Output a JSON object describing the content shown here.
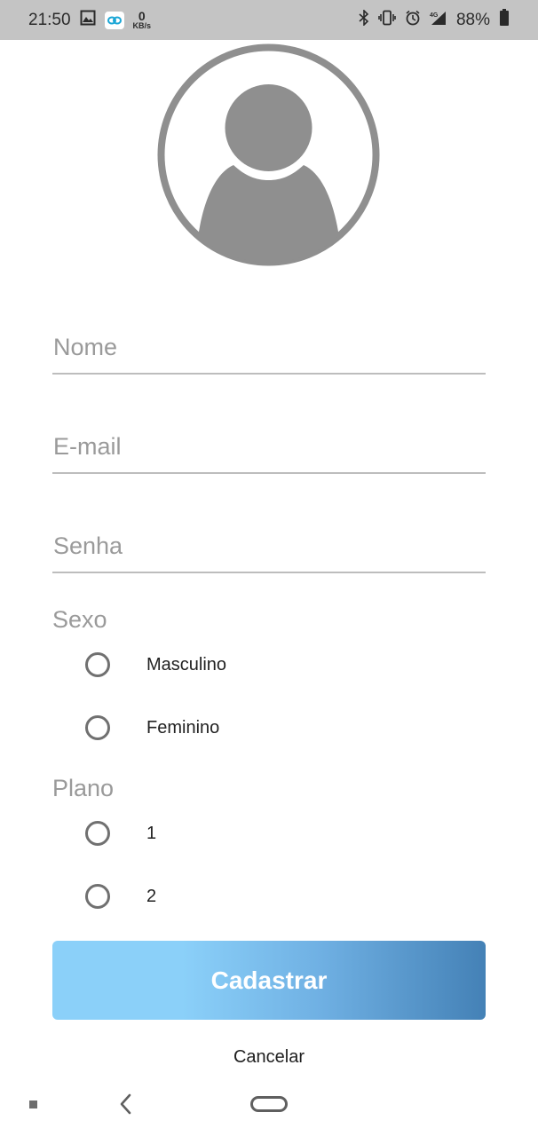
{
  "status_bar": {
    "time": "21:50",
    "net_speed_value": "0",
    "net_speed_unit": "KB/s",
    "battery_percent": "88%",
    "icons": [
      "image-icon",
      "app-badge-icon",
      "bluetooth-icon",
      "vibrate-icon",
      "alarm-icon",
      "signal-4g-icon",
      "battery-icon"
    ],
    "signal_label": "4G"
  },
  "form": {
    "name_placeholder": "Nome",
    "email_placeholder": "E-mail",
    "password_placeholder": "Senha",
    "sex_label": "Sexo",
    "sex_options": [
      "Masculino",
      "Feminino"
    ],
    "plan_label": "Plano",
    "plan_options": [
      "1",
      "2"
    ]
  },
  "actions": {
    "submit_label": "Cadastrar",
    "cancel_label": "Cancelar"
  },
  "colors": {
    "avatar_gray": "#8f8f8f",
    "button_gradient_start": "#8bd0f9",
    "button_gradient_end": "#4481b6",
    "status_bar_bg": "#c4c4c4"
  }
}
